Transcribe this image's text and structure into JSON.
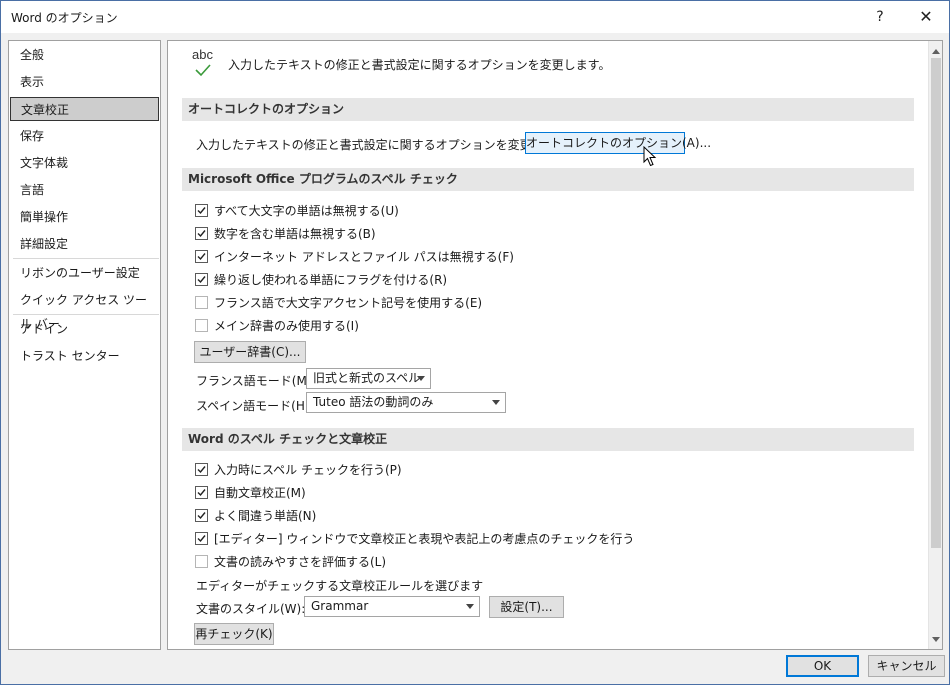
{
  "window": {
    "title": "Word のオプション",
    "help_label": "?",
    "close_label": "✕"
  },
  "sidebar": {
    "items": [
      {
        "label": "全般"
      },
      {
        "label": "表示"
      },
      {
        "label": "文章校正",
        "selected": true
      },
      {
        "label": "保存"
      },
      {
        "label": "文字体裁"
      },
      {
        "label": "言語"
      },
      {
        "label": "簡単操作"
      },
      {
        "label": "詳細設定"
      },
      {
        "label": "リボンのユーザー設定"
      },
      {
        "label": "クイック アクセス ツール バー"
      },
      {
        "label": "アドイン"
      },
      {
        "label": "トラスト センター"
      }
    ]
  },
  "header": {
    "icon_text": "abc",
    "icon": "abc-check-icon",
    "description": "入力したテキストの修正と書式設定に関するオプションを変更します。"
  },
  "autocorrect": {
    "section_title": "オートコレクトのオプション",
    "description": "入力したテキストの修正と書式設定に関するオプションを変更します。",
    "button_label": "オートコレクトのオプション(A)..."
  },
  "office_spelling": {
    "section_title": "Microsoft Office プログラムのスペル チェック",
    "options": [
      {
        "label": "すべて大文字の単語は無視する(U)",
        "checked": true
      },
      {
        "label": "数字を含む単語は無視する(B)",
        "checked": true
      },
      {
        "label": "インターネット アドレスとファイル パスは無視する(F)",
        "checked": true
      },
      {
        "label": "繰り返し使われる単語にフラグを付ける(R)",
        "checked": true
      },
      {
        "label": "フランス語で大文字アクセント記号を使用する(E)",
        "checked": false
      },
      {
        "label": "メイン辞書のみ使用する(I)",
        "checked": false
      }
    ],
    "custom_dict_button": "ユーザー辞書(C)...",
    "french_mode_label": "フランス語モード(M):",
    "french_mode_value": "旧式と新式のスペル",
    "spanish_mode_label": "スペイン語モード(H):",
    "spanish_mode_value": "Tuteo 語法の動詞のみ"
  },
  "word_spelling": {
    "section_title": "Word のスペル チェックと文章校正",
    "options": [
      {
        "label": "入力時にスペル チェックを行う(P)",
        "checked": true
      },
      {
        "label": "自動文章校正(M)",
        "checked": true
      },
      {
        "label": "よく間違う単語(N)",
        "checked": true
      },
      {
        "label": "[エディター] ウィンドウで文章校正と表現や表記上の考慮点のチェックを行う",
        "checked": true
      },
      {
        "label": "文書の読みやすさを評価する(L)",
        "checked": false
      }
    ],
    "rules_label": "エディターがチェックする文章校正ルールを選びます",
    "style_label": "文書のスタイル(W):",
    "style_value": "Grammar",
    "settings_button": "設定(T)...",
    "recheck_button": "再チェック(K)"
  },
  "footer": {
    "ok_label": "OK",
    "cancel_label": "キャンセル"
  },
  "colors": {
    "accent": "#0078d7",
    "check_green": "#3a9a3a",
    "section_bg": "#e6e6e6"
  }
}
